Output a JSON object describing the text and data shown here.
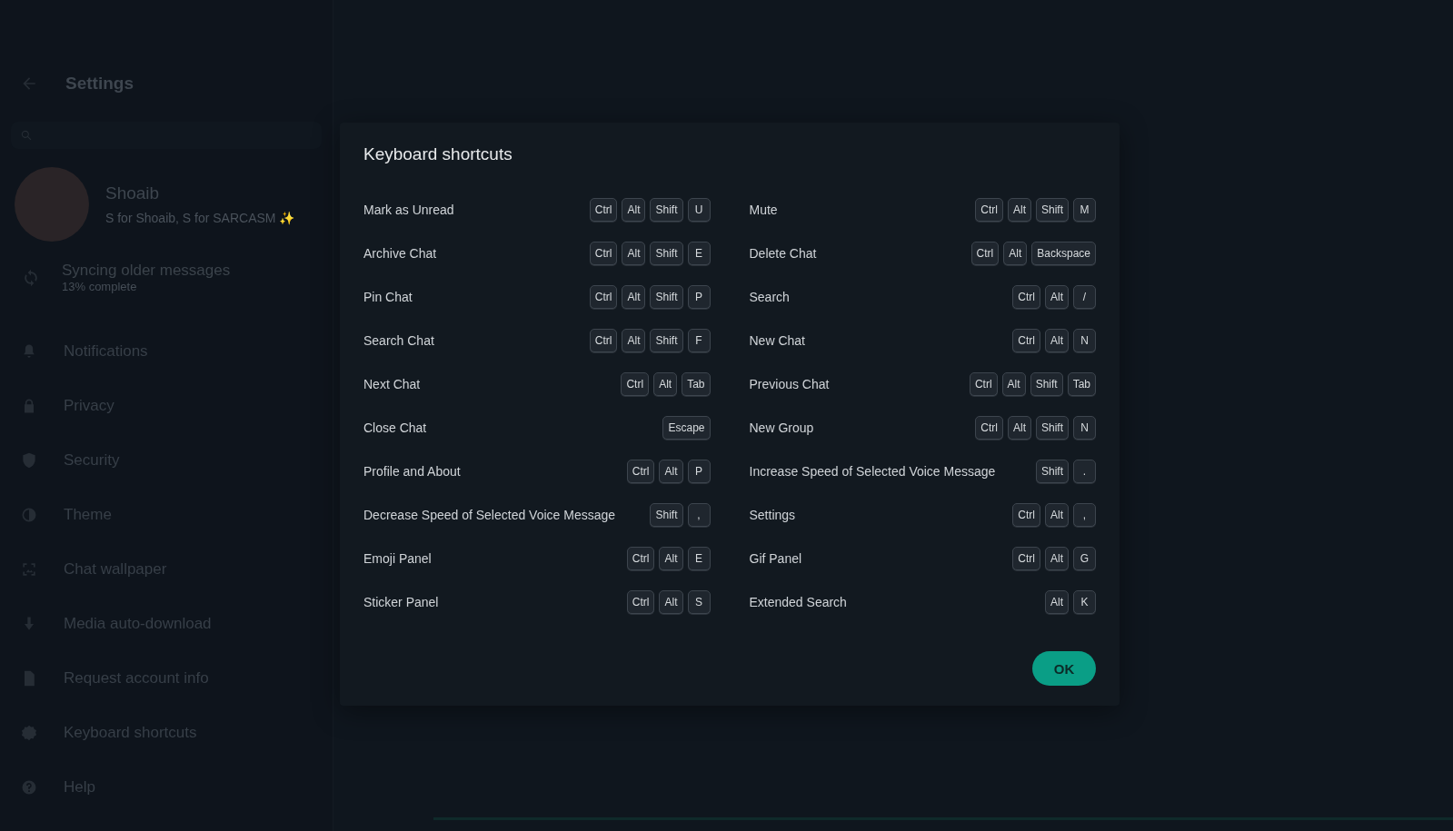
{
  "sidebar": {
    "title": "Settings",
    "profile": {
      "name": "Shoaib",
      "about": "S for Shoaib, S for SARCASM ✨"
    },
    "sync": {
      "title": "Syncing older messages",
      "subtitle": "13% complete"
    },
    "items": [
      {
        "label": "Notifications"
      },
      {
        "label": "Privacy"
      },
      {
        "label": "Security"
      },
      {
        "label": "Theme"
      },
      {
        "label": "Chat wallpaper"
      },
      {
        "label": "Media auto-download"
      },
      {
        "label": "Request account info"
      },
      {
        "label": "Keyboard shortcuts"
      },
      {
        "label": "Help"
      }
    ]
  },
  "dialog": {
    "title": "Keyboard shortcuts",
    "shortcuts": [
      {
        "label": "Mark as Unread",
        "keys": [
          "Ctrl",
          "Alt",
          "Shift",
          "U"
        ]
      },
      {
        "label": "Mute",
        "keys": [
          "Ctrl",
          "Alt",
          "Shift",
          "M"
        ]
      },
      {
        "label": "Archive Chat",
        "keys": [
          "Ctrl",
          "Alt",
          "Shift",
          "E"
        ]
      },
      {
        "label": "Delete Chat",
        "keys": [
          "Ctrl",
          "Alt",
          "Backspace"
        ]
      },
      {
        "label": "Pin Chat",
        "keys": [
          "Ctrl",
          "Alt",
          "Shift",
          "P"
        ]
      },
      {
        "label": "Search",
        "keys": [
          "Ctrl",
          "Alt",
          "/"
        ]
      },
      {
        "label": "Search Chat",
        "keys": [
          "Ctrl",
          "Alt",
          "Shift",
          "F"
        ]
      },
      {
        "label": "New Chat",
        "keys": [
          "Ctrl",
          "Alt",
          "N"
        ]
      },
      {
        "label": "Next Chat",
        "keys": [
          "Ctrl",
          "Alt",
          "Tab"
        ]
      },
      {
        "label": "Previous Chat",
        "keys": [
          "Ctrl",
          "Alt",
          "Shift",
          "Tab"
        ]
      },
      {
        "label": "Close Chat",
        "keys": [
          "Escape"
        ]
      },
      {
        "label": "New Group",
        "keys": [
          "Ctrl",
          "Alt",
          "Shift",
          "N"
        ]
      },
      {
        "label": "Profile and About",
        "keys": [
          "Ctrl",
          "Alt",
          "P"
        ]
      },
      {
        "label": "Increase Speed of Selected Voice Message",
        "keys": [
          "Shift",
          "."
        ]
      },
      {
        "label": "Decrease Speed of Selected Voice Message",
        "keys": [
          "Shift",
          ","
        ]
      },
      {
        "label": "Settings",
        "keys": [
          "Ctrl",
          "Alt",
          ","
        ]
      },
      {
        "label": "Emoji Panel",
        "keys": [
          "Ctrl",
          "Alt",
          "E"
        ]
      },
      {
        "label": "Gif Panel",
        "keys": [
          "Ctrl",
          "Alt",
          "G"
        ]
      },
      {
        "label": "Sticker Panel",
        "keys": [
          "Ctrl",
          "Alt",
          "S"
        ]
      },
      {
        "label": "Extended Search",
        "keys": [
          "Alt",
          "K"
        ]
      }
    ],
    "button": "OK"
  }
}
